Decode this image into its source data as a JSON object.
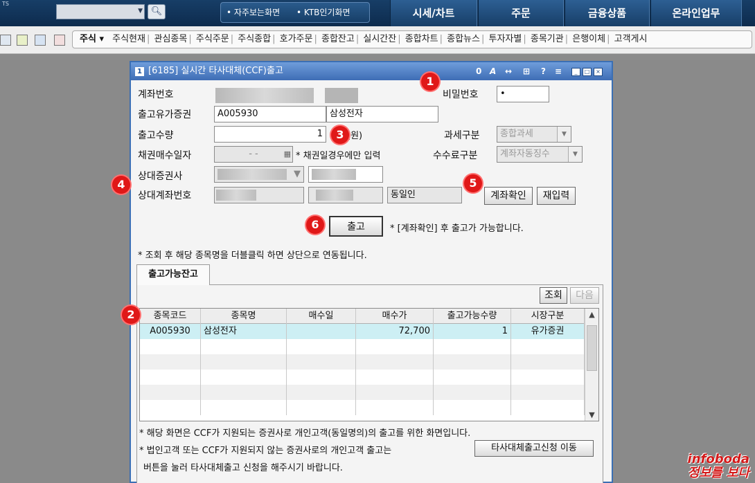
{
  "topbar": {
    "ts_label": "TS",
    "search_placeholder": "",
    "quick_links": [
      "자주보는화면",
      "KTB인기화면"
    ],
    "menus": [
      "시세/차트",
      "주문",
      "금융상품",
      "온라인업무"
    ]
  },
  "toolbar": {
    "first": "주식",
    "items": [
      "주식현재",
      "관심종목",
      "주식주문",
      "주식종합",
      "호가주문",
      "종합잔고",
      "실시간잔",
      "종합차트",
      "종합뉴스",
      "투자자별",
      "종목기관",
      "은행이체",
      "고객게시"
    ]
  },
  "window": {
    "number": "1",
    "title": "[6185] 실시간 타사대체(CCF)출고",
    "controls": [
      "0",
      "A",
      "↔",
      "⊞",
      "?",
      "≡"
    ]
  },
  "form": {
    "account_label": "계좌번호",
    "password_label": "비밀번호",
    "password_value": "•",
    "security_label": "출고유가증권",
    "security_code": "A005930",
    "security_name": "삼성전자",
    "qty_label": "출고수량",
    "qty_value": "1",
    "qty_unit": "(원)",
    "tax_label": "과세구분",
    "tax_value": "종합과세",
    "bond_date_label": "채권매수일자",
    "bond_date_value": "-   -",
    "bond_note": "* 채권일경우에만 입력",
    "fee_label": "수수료구분",
    "fee_value": "계좌자동징수",
    "counter_firm_label": "상대증권사",
    "counter_account_label": "상대계좌번호",
    "same_person": "동일인",
    "check_account_btn": "계좌확인",
    "reset_btn": "재입력",
    "submit_btn": "출고",
    "submit_note": "* [계좌확인] 후 출고가 가능합니다.",
    "dblclick_note": "* 조회 후 해당 종목명을 더블클릭 하면 상단으로 연동됩니다."
  },
  "markers": [
    "1",
    "2",
    "3",
    "4",
    "5",
    "6"
  ],
  "tabs": {
    "balance_tab": "출고가능잔고"
  },
  "grid": {
    "query_btn": "조회",
    "next_btn": "다음",
    "headers": [
      "종목코드",
      "종목명",
      "매수일",
      "매수가",
      "출고가능수량",
      "시장구분"
    ],
    "rows": [
      [
        "A005930",
        "삼성전자",
        "",
        "72,700",
        "1",
        "유가증권"
      ]
    ]
  },
  "notes": {
    "line1": "* 해당 화면은 CCF가 지원되는 증권사로 개인고객(동일명의)의 출고를 위한 화면입니다.",
    "line2": "* 법인고객 또는 CCF가 지원되지 않는 증권사로의 개인고객 출고는",
    "line3": "버튼을 눌러 타사대체출고 신청을 해주시기 바랍니다.",
    "move_btn": "타사대체출고신청 이동"
  },
  "watermark": {
    "line1": "infoboda",
    "line2": "정보를 보다"
  }
}
